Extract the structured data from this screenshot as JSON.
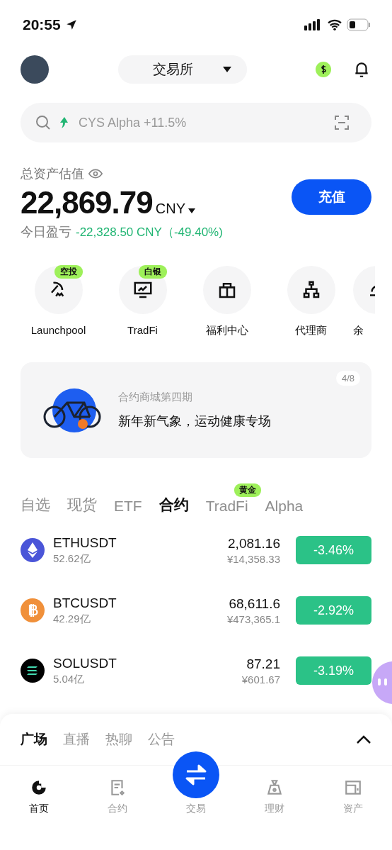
{
  "status_bar": {
    "time": "20:55"
  },
  "header": {
    "exchange_selector": "交易所"
  },
  "search": {
    "placeholder": "CYS Alpha +11.5%"
  },
  "assets": {
    "label": "总资产估值",
    "amount": "22,869.79",
    "currency": "CNY",
    "pnl_label": "今日盈亏",
    "pnl_value": "-22,328.50 CNY（-49.40%)",
    "deposit_button": "充值"
  },
  "shortcuts": [
    {
      "kind": "launchpool",
      "label": "Launchpool",
      "badge": "空投"
    },
    {
      "kind": "tradfi",
      "label": "TradFi",
      "badge": "白银"
    },
    {
      "kind": "gift",
      "label": "福利中心"
    },
    {
      "kind": "agent",
      "label": "代理商"
    },
    {
      "kind": "savings",
      "label": "余"
    }
  ],
  "banner": {
    "subtitle": "合约商城第四期",
    "title": "新年新气象，运动健康专场",
    "page": "4/8"
  },
  "market_tabs": [
    {
      "label": "自选",
      "selected": false
    },
    {
      "label": "现货",
      "selected": false
    },
    {
      "label": "ETF",
      "selected": false
    },
    {
      "label": "合约",
      "selected": true
    },
    {
      "label": "TradFi",
      "selected": false,
      "badge": "黄金"
    },
    {
      "label": "Alpha",
      "selected": false
    }
  ],
  "markets": [
    {
      "kind": "eth",
      "symbol": "ETHUSDT",
      "volume": "52.62亿",
      "price": "2,081.16",
      "price_cny": "¥14,358.33",
      "change": "-3.46%"
    },
    {
      "kind": "btc",
      "symbol": "BTCUSDT",
      "volume": "42.29亿",
      "price": "68,611.6",
      "price_cny": "¥473,365.1",
      "change": "-2.92%"
    },
    {
      "kind": "sol",
      "symbol": "SOLUSDT",
      "volume": "5.04亿",
      "price": "87.21",
      "price_cny": "¥601.67",
      "change": "-3.19%"
    }
  ],
  "feed_tabs": [
    {
      "label": "广场",
      "selected": true
    },
    {
      "label": "直播",
      "selected": false
    },
    {
      "label": "热聊",
      "selected": false
    },
    {
      "label": "公告",
      "selected": false
    }
  ],
  "nav": [
    {
      "kind": "home",
      "label": "首页",
      "selected": true
    },
    {
      "kind": "futures",
      "label": "合约",
      "selected": false
    },
    {
      "kind": "trade",
      "label": "交易",
      "selected": false
    },
    {
      "kind": "earn",
      "label": "理财",
      "selected": false
    },
    {
      "kind": "assets",
      "label": "资产",
      "selected": false
    }
  ]
}
